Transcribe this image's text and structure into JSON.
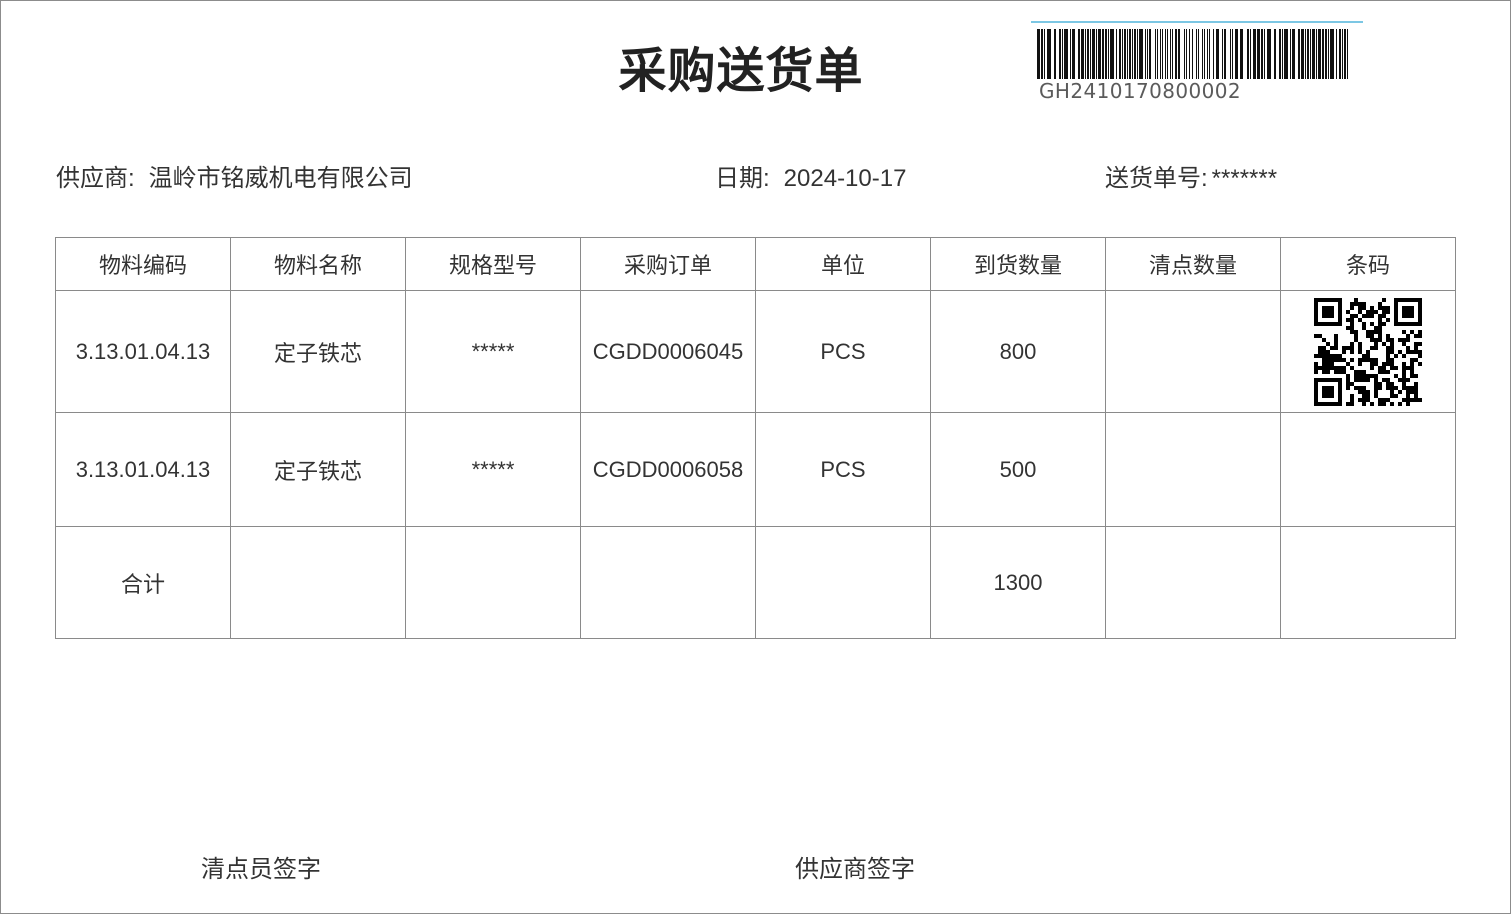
{
  "document": {
    "title": "采购送货单",
    "barcode_number": "GH2410170800002"
  },
  "info": {
    "supplier_label": "供应商:",
    "supplier_value": "温岭市铭威机电有限公司",
    "date_label": "日期:",
    "date_value": "2024-10-17",
    "delivery_no_label": "送货单号:",
    "delivery_no_value": "*******"
  },
  "table": {
    "headers": [
      "物料编码",
      "物料名称",
      "规格型号",
      "采购订单",
      "单位",
      "到货数量",
      "清点数量",
      "条码"
    ],
    "rows": [
      {
        "material_code": "3.13.01.04.13",
        "material_name": "定子铁芯",
        "spec": "*****",
        "purchase_order": "CGDD0006045",
        "unit": "PCS",
        "arrived_qty": "800",
        "counted_qty": "",
        "has_qr": true
      },
      {
        "material_code": "3.13.01.04.13",
        "material_name": "定子铁芯",
        "spec": "*****",
        "purchase_order": "CGDD0006058",
        "unit": "PCS",
        "arrived_qty": "500",
        "counted_qty": "",
        "has_qr": false
      }
    ],
    "total": {
      "label": "合计",
      "arrived_qty": "1300"
    }
  },
  "signatures": {
    "counter": "清点员签字",
    "supplier": "供应商签字"
  },
  "icons": [
    "barcode-icon",
    "qr-code-icon"
  ],
  "colors": {
    "text": "#333333",
    "border": "#8a8a8a",
    "barcode_line": "#7cc7e4"
  }
}
